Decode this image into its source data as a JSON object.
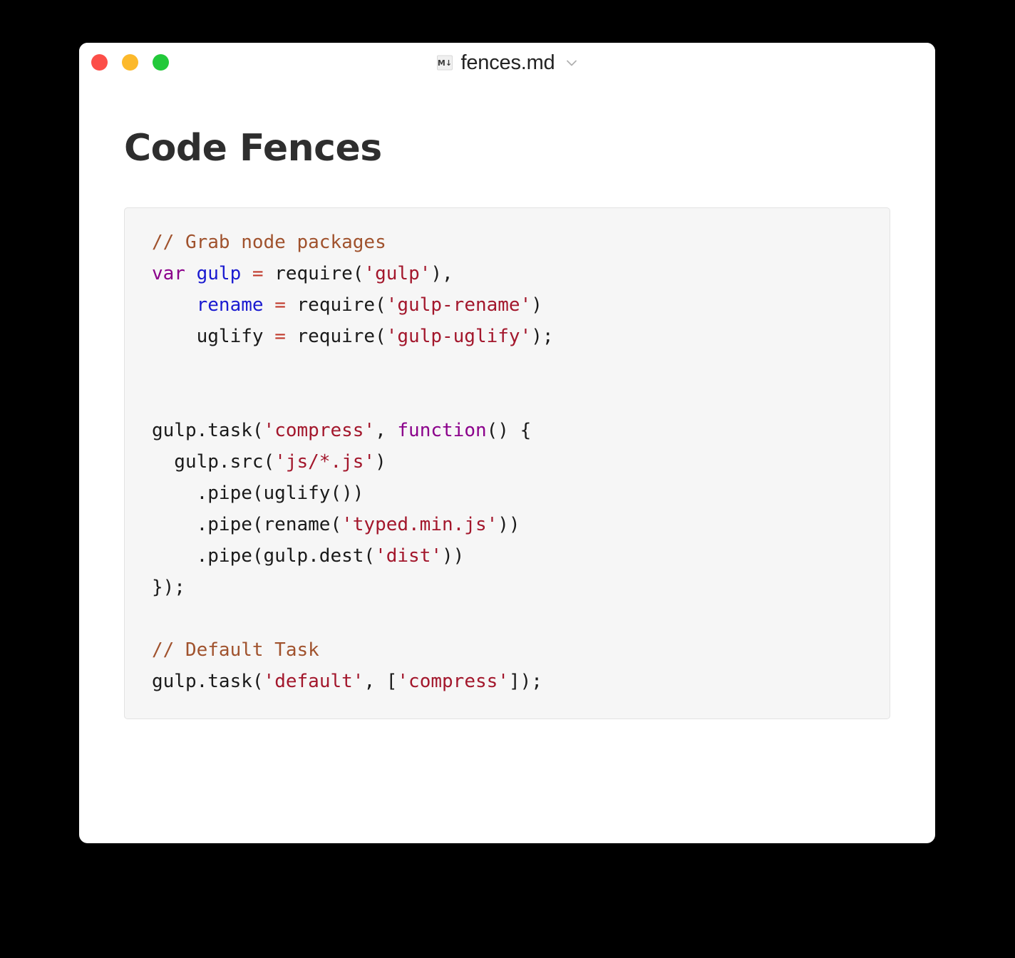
{
  "window": {
    "traffic_lights": [
      {
        "name": "close",
        "label": "Close",
        "color": "#fc4e48"
      },
      {
        "name": "minimize",
        "label": "Minimize",
        "color": "#fcb92b"
      },
      {
        "name": "maximize",
        "label": "Maximize",
        "color": "#22c93a"
      }
    ],
    "title": "fences.md",
    "file_icon": "markdown-file-icon",
    "dropdown_icon": "chevron-down-icon",
    "background": "#ffffff"
  },
  "document": {
    "heading": "Code Fences",
    "heading_color": "#2e2e2e"
  },
  "code_block": {
    "language": "javascript",
    "background": "#f6f6f6",
    "border_color": "#e2e2e2",
    "palette": {
      "comment": "#a0522d",
      "keyword": "#8b008b",
      "variable": "#1a1ad0",
      "string": "#a3172c",
      "operator": "#c0392b",
      "plain": "#1a1a1a"
    },
    "lines": [
      {
        "tokens": [
          {
            "t": "comment",
            "v": "// Grab node packages"
          }
        ]
      },
      {
        "tokens": [
          {
            "t": "keyword",
            "v": "var"
          },
          {
            "t": "plain",
            "v": " "
          },
          {
            "t": "variable",
            "v": "gulp"
          },
          {
            "t": "plain",
            "v": " "
          },
          {
            "t": "operator",
            "v": "="
          },
          {
            "t": "plain",
            "v": " require("
          },
          {
            "t": "string",
            "v": "'gulp'"
          },
          {
            "t": "plain",
            "v": "),"
          }
        ]
      },
      {
        "tokens": [
          {
            "t": "plain",
            "v": "    "
          },
          {
            "t": "variable",
            "v": "rename"
          },
          {
            "t": "plain",
            "v": " "
          },
          {
            "t": "operator",
            "v": "="
          },
          {
            "t": "plain",
            "v": " require("
          },
          {
            "t": "string",
            "v": "'gulp-rename'"
          },
          {
            "t": "plain",
            "v": ")"
          }
        ]
      },
      {
        "tokens": [
          {
            "t": "plain",
            "v": "    uglify "
          },
          {
            "t": "operator",
            "v": "="
          },
          {
            "t": "plain",
            "v": " require("
          },
          {
            "t": "string",
            "v": "'gulp-uglify'"
          },
          {
            "t": "plain",
            "v": ");"
          }
        ]
      },
      {
        "tokens": []
      },
      {
        "tokens": []
      },
      {
        "tokens": [
          {
            "t": "plain",
            "v": "gulp.task("
          },
          {
            "t": "string",
            "v": "'compress'"
          },
          {
            "t": "plain",
            "v": ", "
          },
          {
            "t": "keyword",
            "v": "function"
          },
          {
            "t": "plain",
            "v": "() {"
          }
        ]
      },
      {
        "tokens": [
          {
            "t": "plain",
            "v": "  gulp.src("
          },
          {
            "t": "string",
            "v": "'js/*.js'"
          },
          {
            "t": "plain",
            "v": ")"
          }
        ]
      },
      {
        "tokens": [
          {
            "t": "plain",
            "v": "    .pipe(uglify())"
          }
        ]
      },
      {
        "tokens": [
          {
            "t": "plain",
            "v": "    .pipe(rename("
          },
          {
            "t": "string",
            "v": "'typed.min.js'"
          },
          {
            "t": "plain",
            "v": "))"
          }
        ]
      },
      {
        "tokens": [
          {
            "t": "plain",
            "v": "    .pipe(gulp.dest("
          },
          {
            "t": "string",
            "v": "'dist'"
          },
          {
            "t": "plain",
            "v": "))"
          }
        ]
      },
      {
        "tokens": [
          {
            "t": "plain",
            "v": "});"
          }
        ]
      },
      {
        "tokens": []
      },
      {
        "tokens": [
          {
            "t": "comment",
            "v": "// Default Task"
          }
        ]
      },
      {
        "tokens": [
          {
            "t": "plain",
            "v": "gulp.task("
          },
          {
            "t": "string",
            "v": "'default'"
          },
          {
            "t": "plain",
            "v": ", ["
          },
          {
            "t": "string",
            "v": "'compress'"
          },
          {
            "t": "plain",
            "v": "]);"
          }
        ]
      }
    ]
  }
}
